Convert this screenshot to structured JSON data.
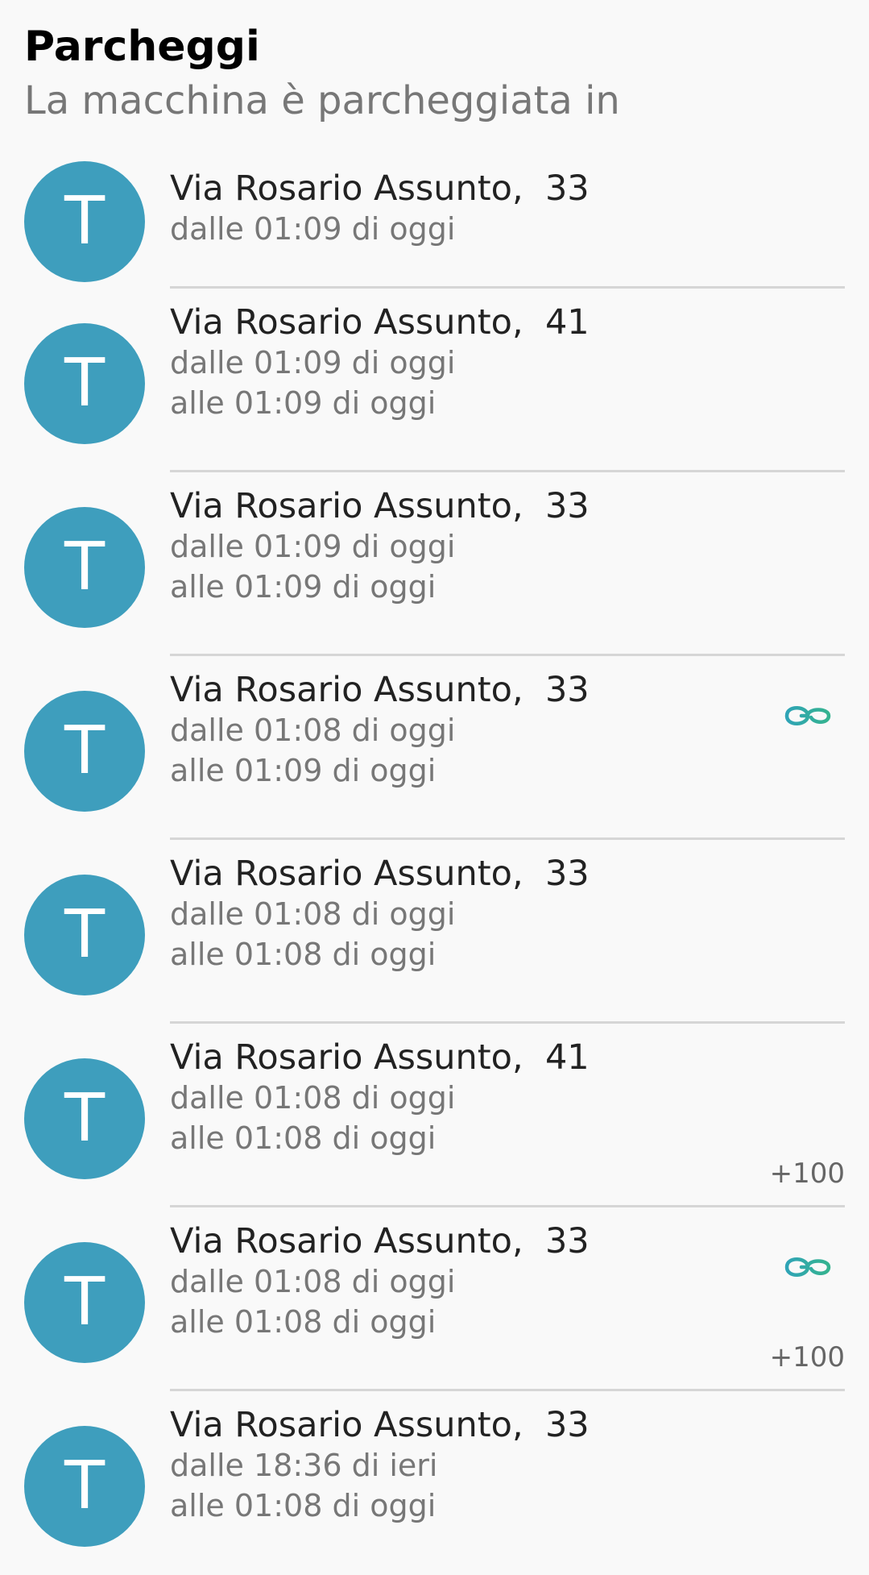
{
  "header": {
    "title": "Parcheggi",
    "subtitle": "La macchina è parcheggiata in"
  },
  "colors": {
    "avatar_bg": "#3e9ebd",
    "avatar_text": "#ffffff",
    "link_icon_teal": "#2fa4b6",
    "link_icon_green": "#35b38f",
    "divider": "#d6d6d6"
  },
  "parkings": [
    {
      "avatar": "T",
      "address": "Via Rosario Assunto,  33",
      "from": "dalle 01:09 di oggi"
    },
    {
      "avatar": "T",
      "address": "Via Rosario Assunto,  41",
      "from": "dalle 01:09 di oggi",
      "to": "alle 01:09 di oggi"
    },
    {
      "avatar": "T",
      "address": "Via Rosario Assunto,  33",
      "from": "dalle 01:09 di oggi",
      "to": "alle 01:09 di oggi"
    },
    {
      "avatar": "T",
      "address": "Via Rosario Assunto,  33",
      "from": "dalle 01:08 di oggi",
      "to": "alle 01:09 di oggi",
      "icon": "link-icon"
    },
    {
      "avatar": "T",
      "address": "Via Rosario Assunto,  33",
      "from": "dalle 01:08 di oggi",
      "to": "alle 01:08 di oggi"
    },
    {
      "avatar": "T",
      "address": "Via Rosario Assunto,  41",
      "from": "dalle 01:08 di oggi",
      "to": "alle 01:08 di oggi",
      "points": "+100"
    },
    {
      "avatar": "T",
      "address": "Via Rosario Assunto,  33",
      "from": "dalle 01:08 di oggi",
      "to": "alle 01:08 di oggi",
      "icon": "link-icon",
      "points": "+100"
    },
    {
      "avatar": "T",
      "address": "Via Rosario Assunto,  33",
      "from": "dalle 18:36 di ieri",
      "to": "alle 01:08 di oggi"
    }
  ]
}
